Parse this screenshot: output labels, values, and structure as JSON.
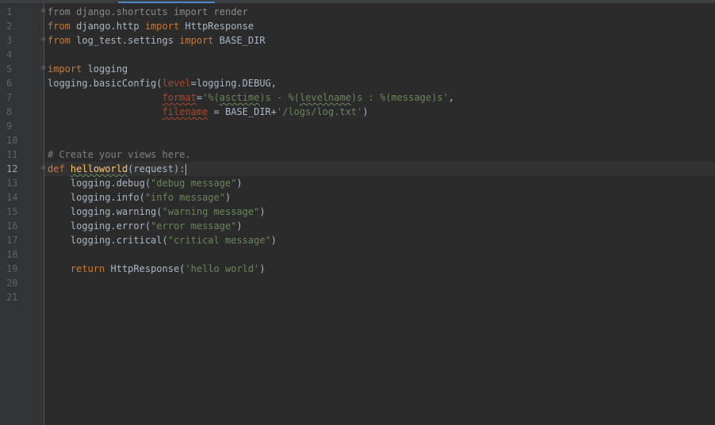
{
  "line_numbers": [
    "1",
    "2",
    "3",
    "4",
    "5",
    "6",
    "7",
    "8",
    "9",
    "10",
    "11",
    "12",
    "13",
    "14",
    "15",
    "16",
    "17",
    "18",
    "19",
    "20",
    "21"
  ],
  "current_line": "12",
  "code": {
    "l1_from": "from",
    "l1_mod": " django.shortcuts ",
    "l1_import": "import",
    "l1_name": " render",
    "l2_from": "from",
    "l2_mod": " django.http ",
    "l2_import": "import",
    "l2_name": " HttpResponse",
    "l3_from": "from",
    "l3_mod": " log_test.settings ",
    "l3_import": "import",
    "l3_name": " BASE_DIR",
    "l5_import": "import",
    "l5_name": " logging",
    "l6_a": "logging.basicConfig(",
    "l6_param": "level",
    "l6_b": "=logging.DEBUG,",
    "l7_indent": "                    ",
    "l7_param": "format",
    "l7_eq": "=",
    "l7_s1": "'%(",
    "l7_s2": "asctime",
    "l7_s3": ")s - %(",
    "l7_s4": "levelname",
    "l7_s5": ")s : %(message)s'",
    "l7_end": ",",
    "l8_indent": "                    ",
    "l8_param": "filename",
    "l8_b": " = BASE_DIR+",
    "l8_str": "'/logs/log.txt'",
    "l8_end": ")",
    "l11_comment": "# Create your views here.",
    "l12_def": "def",
    "l12_sp": " ",
    "l12_fn": "helloworld",
    "l12_rest": "(request):",
    "l13_a": "    logging.debug(",
    "l13_s": "\"debug message\"",
    "l13_b": ")",
    "l14_a": "    logging.info(",
    "l14_s": "\"info message\"",
    "l14_b": ")",
    "l15_a": "    logging.warning(",
    "l15_s": "\"warning message\"",
    "l15_b": ")",
    "l16_a": "    logging.error(",
    "l16_s": "\"error message\"",
    "l16_b": ")",
    "l17_a": "    logging.critical(",
    "l17_s": "\"critical message\"",
    "l17_b": ")",
    "l19_indent": "    ",
    "l19_kw": "return",
    "l19_a": " HttpResponse(",
    "l19_s": "'hello world'",
    "l19_b": ")"
  },
  "colors": {
    "background": "#2b2b2b",
    "keyword": "#cc7832",
    "string": "#6a8759",
    "comment": "#808080",
    "parameter": "#aa4926",
    "text": "#a9b7c6"
  },
  "icons": {
    "fold_marker": "fold-icon"
  }
}
